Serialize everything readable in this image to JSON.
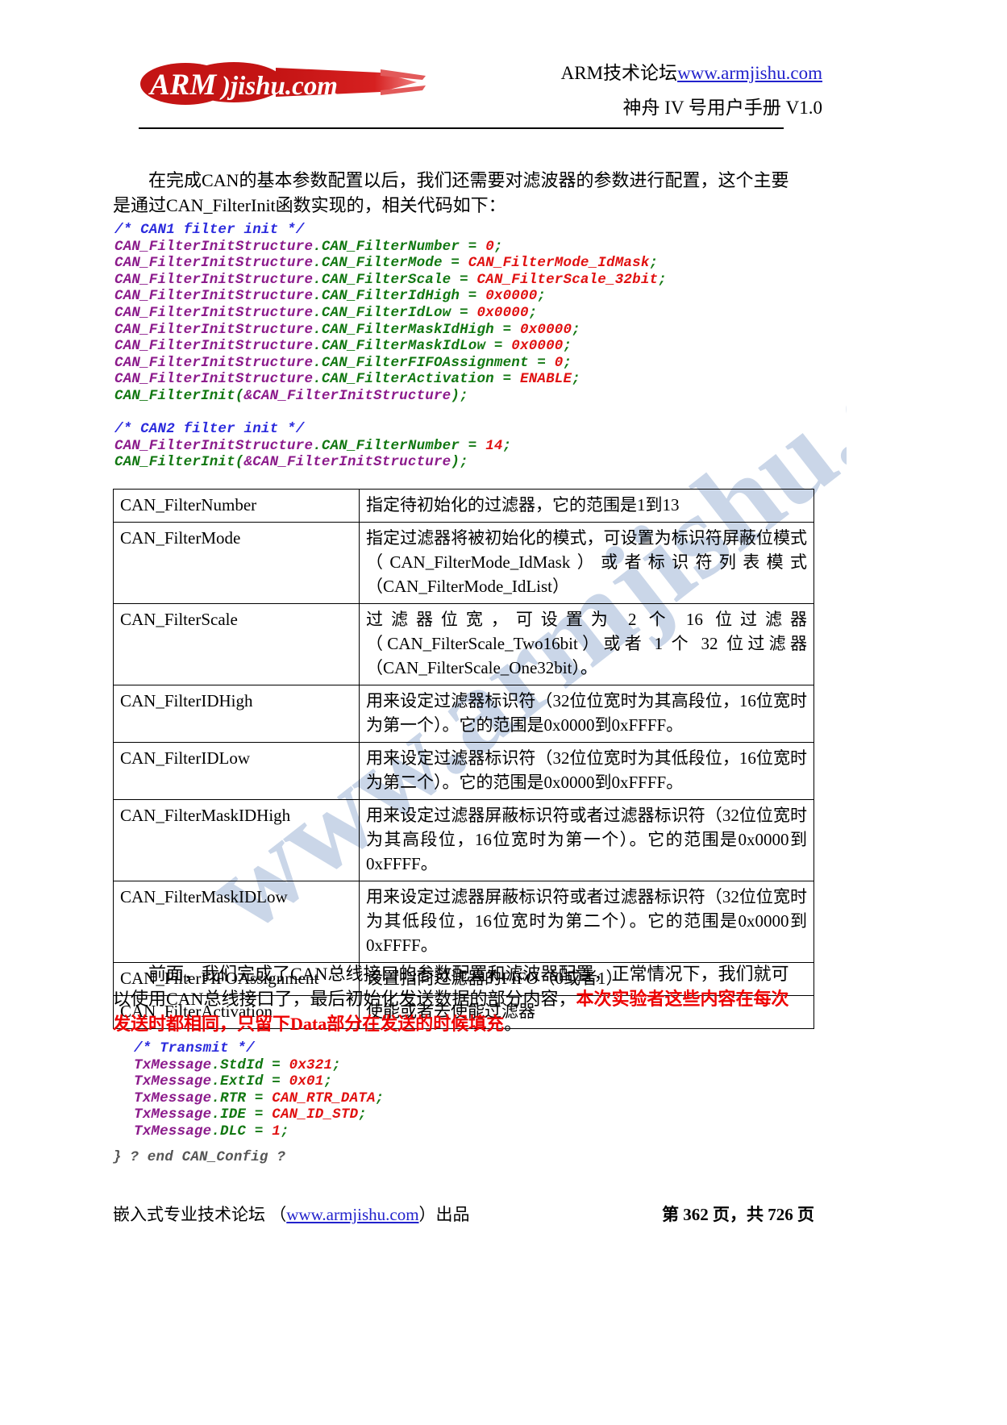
{
  "header": {
    "logo_text_left": "ARM",
    "logo_text_right": "jishu.com",
    "title_prefix": "ARM技术论坛",
    "title_site": "www.armjishu.com",
    "subtitle": "神舟 IV 号用户手册 V1.0"
  },
  "paragraphs": {
    "intro_line1": "在完成CAN的基本参数配置以后，我们还需要对滤波器的参数进行配置，这个主要",
    "intro_line2": "是通过CAN_FilterInit函数实现的，相关代码如下：",
    "after_table_line1": "前面，我们完成了CAN总线接口的参数配置和滤波器配置，正常情况下，我们就可",
    "after_table_line2_black": "以使用CAN总线接口了，最后初始化发送数据的部分内容，",
    "after_table_line2_red": "本次实验者这些内容在每次",
    "after_table_line3_red": "发送时都相同，只留下Data部分在发送的时候填充",
    "after_table_line3_tail": "。"
  },
  "code_block_1": {
    "comment_can1": "/* CAN1 filter init */",
    "comment_can2": "/* CAN2 filter init */",
    "struct_name": "CAN_FilterInitStructure",
    "lines": [
      {
        "member": "CAN_FilterNumber",
        "value": "0"
      },
      {
        "member": "CAN_FilterMode",
        "value": "CAN_FilterMode_IdMask"
      },
      {
        "member": "CAN_FilterScale",
        "value": "CAN_FilterScale_32bit"
      },
      {
        "member": "CAN_FilterIdHigh",
        "value": "0x0000"
      },
      {
        "member": "CAN_FilterIdLow",
        "value": "0x0000"
      },
      {
        "member": "CAN_FilterMaskIdHigh",
        "value": "0x0000"
      },
      {
        "member": "CAN_FilterMaskIdLow",
        "value": "0x0000"
      },
      {
        "member": "CAN_FilterFIFOAssignment",
        "value": "0"
      },
      {
        "member": "CAN_FilterActivation",
        "value": "ENABLE"
      }
    ],
    "call_fn": "CAN_FilterInit",
    "call_arg": "&CAN_FilterInitStructure",
    "can2_lines": [
      {
        "member": "CAN_FilterNumber",
        "value": "14"
      }
    ]
  },
  "code_block_2": {
    "comment": "/* Transmit */",
    "struct_name": "TxMessage",
    "lines": [
      {
        "member": "StdId",
        "value": "0x321"
      },
      {
        "member": "ExtId",
        "value": "0x01"
      },
      {
        "member": "RTR",
        "value": "CAN_RTR_DATA"
      },
      {
        "member": "IDE",
        "value": "CAN_ID_STD"
      },
      {
        "member": "DLC",
        "value": "1"
      }
    ],
    "end_comment": "} ? end CAN_Config ?"
  },
  "table": {
    "rows": [
      {
        "key": "CAN_FilterNumber",
        "value": "指定待初始化的过滤器，它的范围是1到13",
        "justify": false
      },
      {
        "key": "CAN_FilterMode",
        "value": "指定过滤器将被初始化的模式，可设置为标识符屏蔽位模式（CAN_FilterMode_IdMask）或者标识符列表模式（CAN_FilterMode_IdList）",
        "justify": true
      },
      {
        "key": "CAN_FilterScale",
        "value": "过滤器位宽，可设置为 2 个 16 位过滤器（CAN_FilterScale_Two16bit）或者 1 个 32 位过滤器（CAN_FilterScale_One32bit）。",
        "justify": true
      },
      {
        "key": "CAN_FilterIDHigh",
        "value": "用来设定过滤器标识符（32位位宽时为其高段位，16位宽时为第一个）。它的范围是0x0000到0xFFFF。",
        "justify": false
      },
      {
        "key": "CAN_FilterIDLow",
        "value": "用来设定过滤器标识符（32位位宽时为其低段位，16位宽时为第二个）。它的范围是0x0000到0xFFFF。",
        "justify": false
      },
      {
        "key": "CAN_FilterMaskIDHigh",
        "value": "用来设定过滤器屏蔽标识符或者过滤器标识符（32位位宽时为其高段位，16位宽时为第一个）。它的范围是0x0000到0xFFFF。",
        "justify": false
      },
      {
        "key": "CAN_FilterMaskIDLow",
        "value": "用来设定过滤器屏蔽标识符或者过滤器标识符（32位位宽时为其低段位，16位宽时为第二个）。它的范围是0x0000到0xFFFF。",
        "justify": false
      },
      {
        "key": "CAN_FilterFIFOAssignment",
        "value": "设置指向过滤器的FIFO（0或者1）",
        "justify": false
      },
      {
        "key": "CAN_FilterActivation",
        "value": "使能或者去使能过滤器",
        "justify": false
      }
    ]
  },
  "footer": {
    "left_prefix": "嵌入式专业技术论坛 （",
    "left_link": "www.armjishu.com",
    "left_suffix": "）出品",
    "right": "第 362 页，共 726 页"
  },
  "watermark": {
    "text": "www.armjishu.com"
  },
  "colors": {
    "link": "#2222cc",
    "code_comment": "#2b2bdd",
    "code_struct": "#8b1a8b",
    "code_member": "#117711",
    "code_value": "#e01010",
    "emphasis_red": "#ee0000",
    "logo_red": "#cc1111",
    "watermark_blue": "#9fb6d6"
  }
}
